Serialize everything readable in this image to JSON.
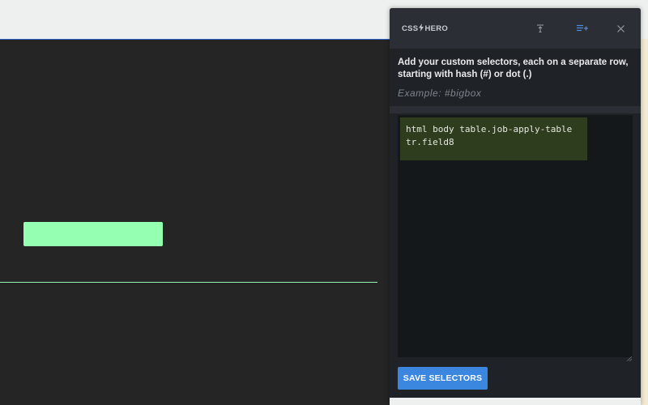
{
  "panel": {
    "logo_left": "CSS",
    "logo_right": "HERO",
    "instructions": "Add your custom selectors, each on a separate row, starting with hash (#) or dot (.)",
    "example": "Example: #bigbox",
    "selectors_value": "html body table.job-apply-table tr.field8",
    "save_label": "SAVE SELECTORS"
  },
  "icons": {
    "logo": "bolt-icon",
    "dock": "dock-top-icon",
    "add_selector": "list-add-icon",
    "close": "close-icon"
  },
  "colors": {
    "accent": "#3b87df",
    "panel_bg": "#1f2226",
    "header_bg": "#2b2f35",
    "editor_bg": "#14181a",
    "highlight": "#2d3d1e",
    "page_green": "#95ffb2"
  }
}
